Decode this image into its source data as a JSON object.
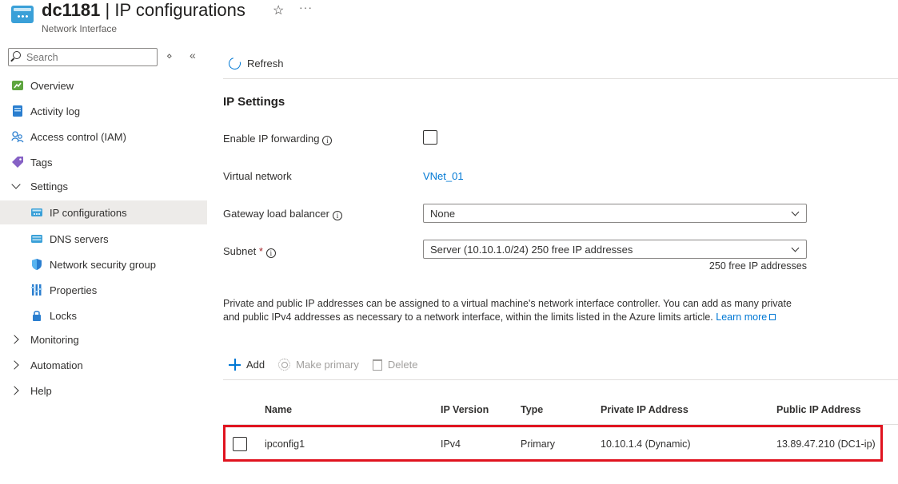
{
  "header": {
    "resource_name": "dc1181",
    "separator": " | ",
    "page": "IP configurations",
    "subtitle": "Network Interface",
    "favorite_icon": "star-icon",
    "more_icon": "ellipsis-icon",
    "more_label": "···"
  },
  "sidebar": {
    "search_placeholder": "Search",
    "items": [
      {
        "label": "Overview",
        "icon": "overview-icon"
      },
      {
        "label": "Activity log",
        "icon": "activity-log-icon"
      },
      {
        "label": "Access control (IAM)",
        "icon": "iam-icon"
      },
      {
        "label": "Tags",
        "icon": "tag-icon"
      },
      {
        "label": "Settings",
        "expanded": true
      },
      {
        "label": "IP configurations",
        "icon": "ip-config-icon",
        "active": true
      },
      {
        "label": "DNS servers",
        "icon": "dns-icon"
      },
      {
        "label": "Network security group",
        "icon": "shield-icon"
      },
      {
        "label": "Properties",
        "icon": "properties-icon"
      },
      {
        "label": "Locks",
        "icon": "lock-icon"
      },
      {
        "label": "Monitoring",
        "expanded": false
      },
      {
        "label": "Automation",
        "expanded": false
      },
      {
        "label": "Help",
        "expanded": false
      }
    ]
  },
  "toolbar": {
    "refresh_label": "Refresh"
  },
  "ip_settings": {
    "title": "IP Settings",
    "ip_forwarding_label": "Enable IP forwarding",
    "ip_forwarding_checked": false,
    "vnet_label": "Virtual network",
    "vnet_value": "VNet_01",
    "gateway_lb_label": "Gateway load balancer",
    "gateway_lb_value": "None",
    "subnet_label": "Subnet",
    "subnet_required": "*",
    "subnet_value": "Server (10.10.1.0/24) 250 free IP addresses",
    "subnet_hint": "250 free IP addresses",
    "info_glyph": "i"
  },
  "description": {
    "text": "Private and public IP addresses can be assigned to a virtual machine's network interface controller. You can add as many private and public IPv4 addresses as necessary to a network interface, within the limits listed in the Azure limits article.",
    "learn_more": "Learn more"
  },
  "actions": {
    "add": "Add",
    "make_primary": "Make primary",
    "delete": "Delete"
  },
  "table": {
    "columns": [
      "Name",
      "IP Version",
      "Type",
      "Private IP Address",
      "Public IP Address"
    ],
    "rows": [
      {
        "name": "ipconfig1",
        "ip_version": "IPv4",
        "type": "Primary",
        "private_ip": "10.10.1.4 (Dynamic)",
        "public_ip": "13.89.47.210 (DC1-ip)",
        "selected": false
      }
    ]
  },
  "colors": {
    "accent": "#0078d4",
    "highlight": "#e0131f"
  }
}
